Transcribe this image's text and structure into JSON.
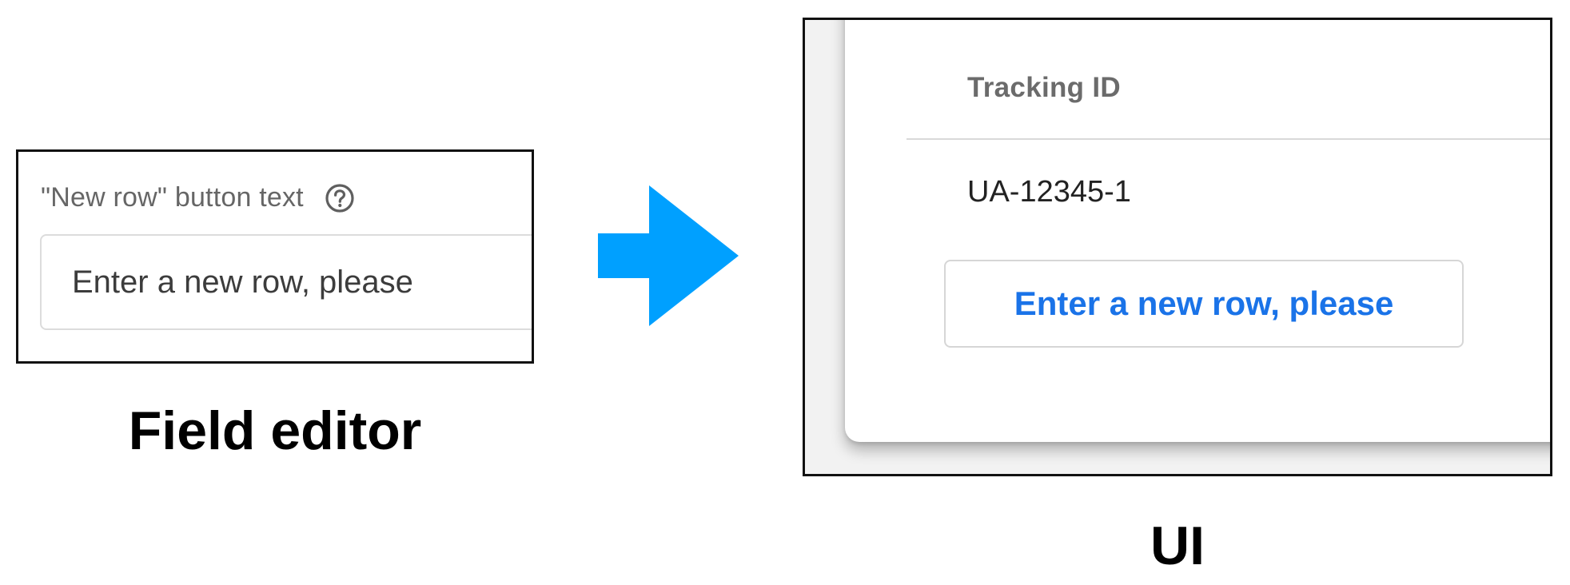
{
  "field_editor": {
    "label": "\"New row\" button text",
    "help_icon": "help-circle-icon",
    "input_value": "Enter a new row, please",
    "caption": "Field editor"
  },
  "arrow": {
    "icon": "arrow-right-icon",
    "color": "#00a0ff"
  },
  "ui": {
    "column_header": "Tracking ID",
    "rows": [
      "UA-12345-1"
    ],
    "new_row_button_label": "Enter a new row, please",
    "button_text_color": "#1a73e8",
    "caption": "UI"
  }
}
